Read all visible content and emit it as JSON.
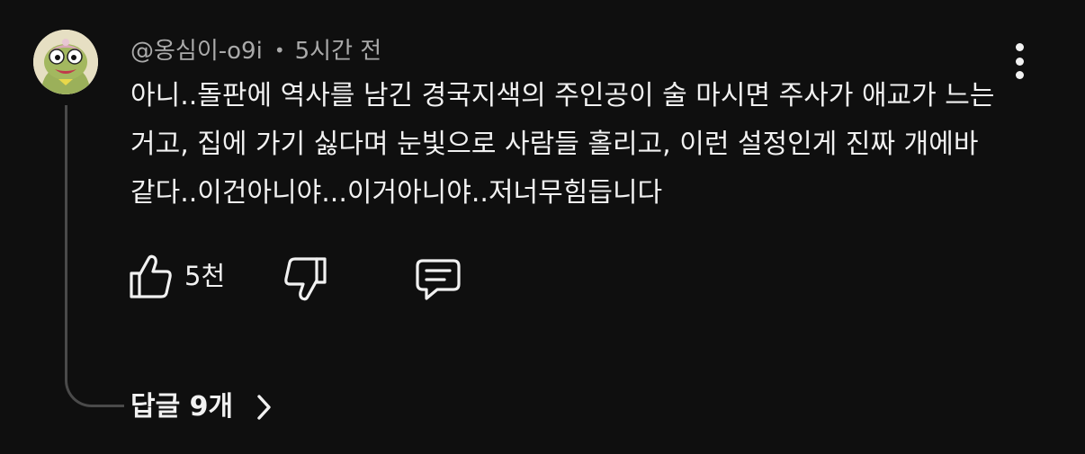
{
  "comment": {
    "author": "@옹심이-o9i",
    "separator": "•",
    "time": "5시간 전",
    "text": "아니..돌판에 역사를 남긴 경국지색의 주인공이 술 마시면 주사가 애교가 느는거고, 집에 가기 싫다며 눈빛으로 사람들 홀리고, 이런 설정인게 진짜 개에바같다..이건아니야...이거아니야..저너무힘듭니다"
  },
  "actions": {
    "like_count": "5천"
  },
  "replies": {
    "label": "답글 9개"
  },
  "icons": {
    "avatar": "frog-character-avatar",
    "more": "more-vert-icon",
    "like": "thumb-up-icon",
    "dislike": "thumb-down-icon",
    "reply": "reply-comment-icon",
    "chevron": "chevron-right-icon"
  }
}
